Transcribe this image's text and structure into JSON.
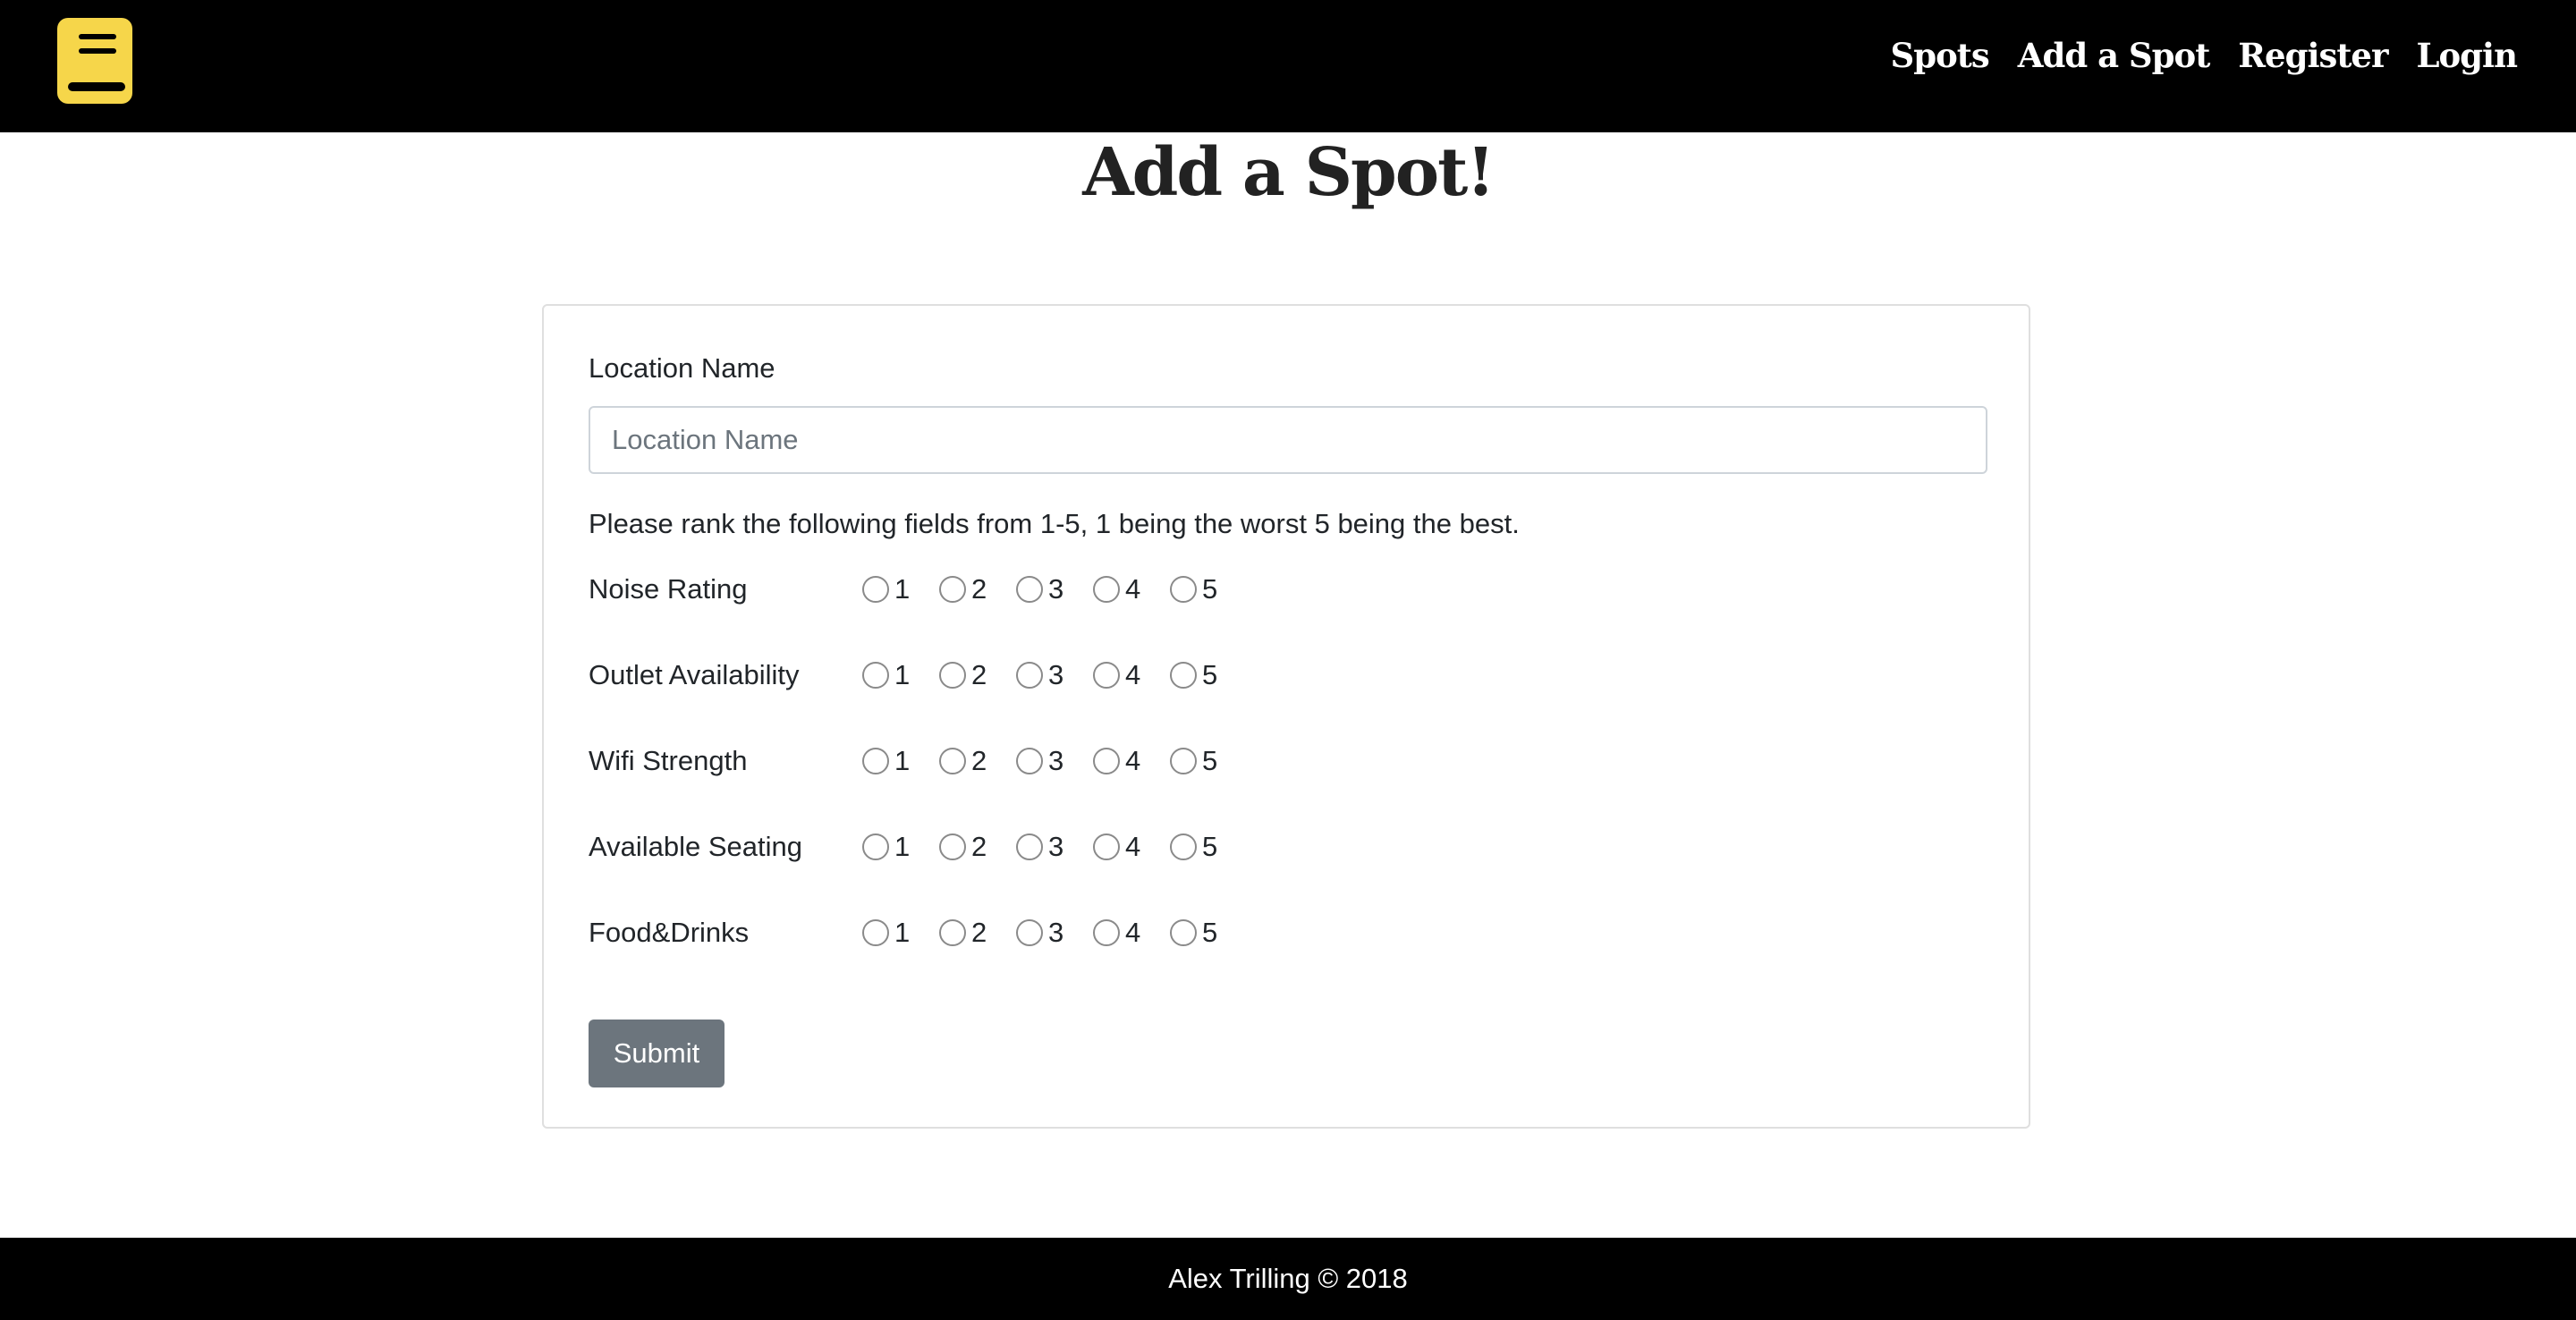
{
  "navbar": {
    "logo_icon": "book-icon",
    "links": [
      "Spots",
      "Add a Spot",
      "Register",
      "Login"
    ]
  },
  "page": {
    "title": "Add a Spot!"
  },
  "form": {
    "location_label": "Location Name",
    "location_placeholder": "Location Name",
    "location_value": "",
    "instructions": "Please rank the following fields from 1-5, 1 being the worst 5 being the best.",
    "ratings": [
      {
        "label": "Noise Rating",
        "options": [
          "1",
          "2",
          "3",
          "4",
          "5"
        ]
      },
      {
        "label": "Outlet Availability",
        "options": [
          "1",
          "2",
          "3",
          "4",
          "5"
        ]
      },
      {
        "label": "Wifi Strength",
        "options": [
          "1",
          "2",
          "3",
          "4",
          "5"
        ]
      },
      {
        "label": "Available Seating",
        "options": [
          "1",
          "2",
          "3",
          "4",
          "5"
        ]
      },
      {
        "label": "Food&Drinks",
        "options": [
          "1",
          "2",
          "3",
          "4",
          "5"
        ]
      }
    ],
    "submit_label": "Submit"
  },
  "footer": {
    "text": "Alex Trilling © 2018"
  },
  "colors": {
    "logo_yellow": "#f6d64a",
    "navbar_bg": "#000000",
    "submit_bg": "#6c757d"
  }
}
